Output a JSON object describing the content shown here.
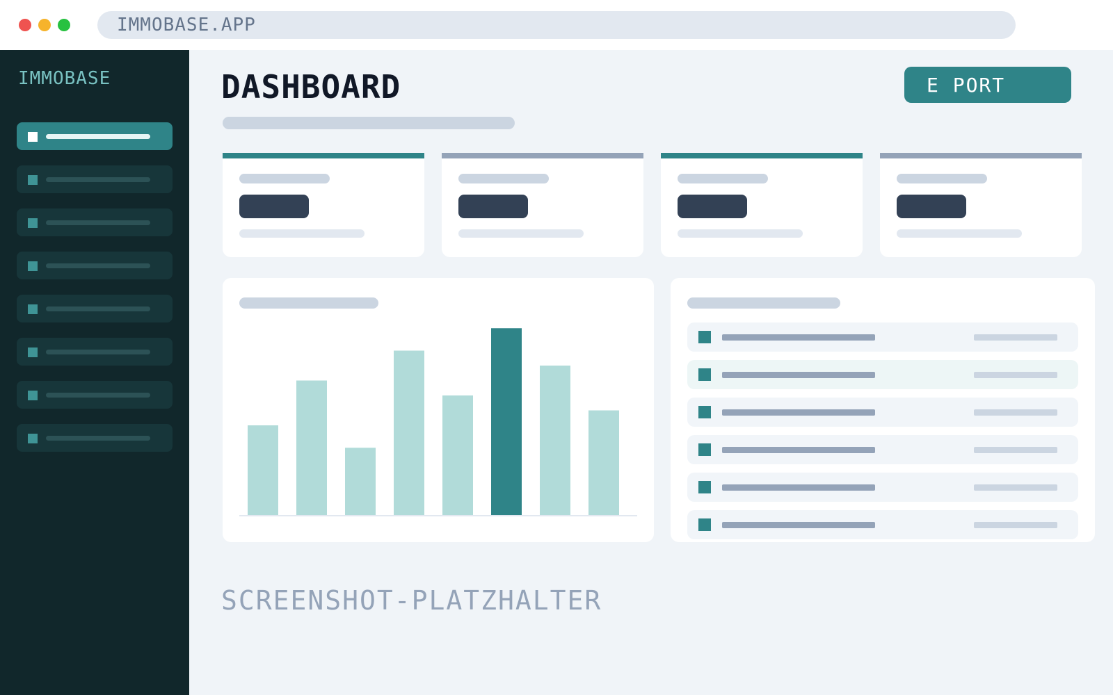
{
  "browser": {
    "address": "IMMOBASE.APP",
    "dots": [
      "#ef5350",
      "#f6b32b",
      "#27c140"
    ]
  },
  "sidebar": {
    "logo": "IMMOBASE",
    "items": [
      {
        "active": true
      },
      {
        "active": false
      },
      {
        "active": false
      },
      {
        "active": false
      },
      {
        "active": false
      },
      {
        "active": false
      },
      {
        "active": false
      },
      {
        "active": false
      }
    ]
  },
  "header": {
    "title": "DASHBOARD",
    "export_label": "E PORT"
  },
  "stat_cards": [
    {
      "accent": "#2f8488"
    },
    {
      "accent": "#94a3b8"
    },
    {
      "accent": "#2f8488"
    },
    {
      "accent": "#94a3b8"
    }
  ],
  "chart_data": {
    "type": "bar",
    "values": [
      30,
      45,
      22.5,
      55,
      40,
      62.5,
      50,
      35
    ],
    "highlight_index": 5,
    "ylim": [
      0,
      70
    ],
    "grid": false,
    "colors": {
      "bar": "#b1dbd9",
      "highlight": "#2f8488"
    }
  },
  "list": {
    "rows": [
      {
        "highlight": false
      },
      {
        "highlight": true
      },
      {
        "highlight": false
      },
      {
        "highlight": false
      },
      {
        "highlight": false
      },
      {
        "highlight": false
      }
    ]
  },
  "placeholder_label": "SCREENSHOT-PLATZHALTER",
  "colors": {
    "accent": "#2f8488",
    "sidebar_bg": "#11272b",
    "page_bg": "#f0f4f8"
  }
}
